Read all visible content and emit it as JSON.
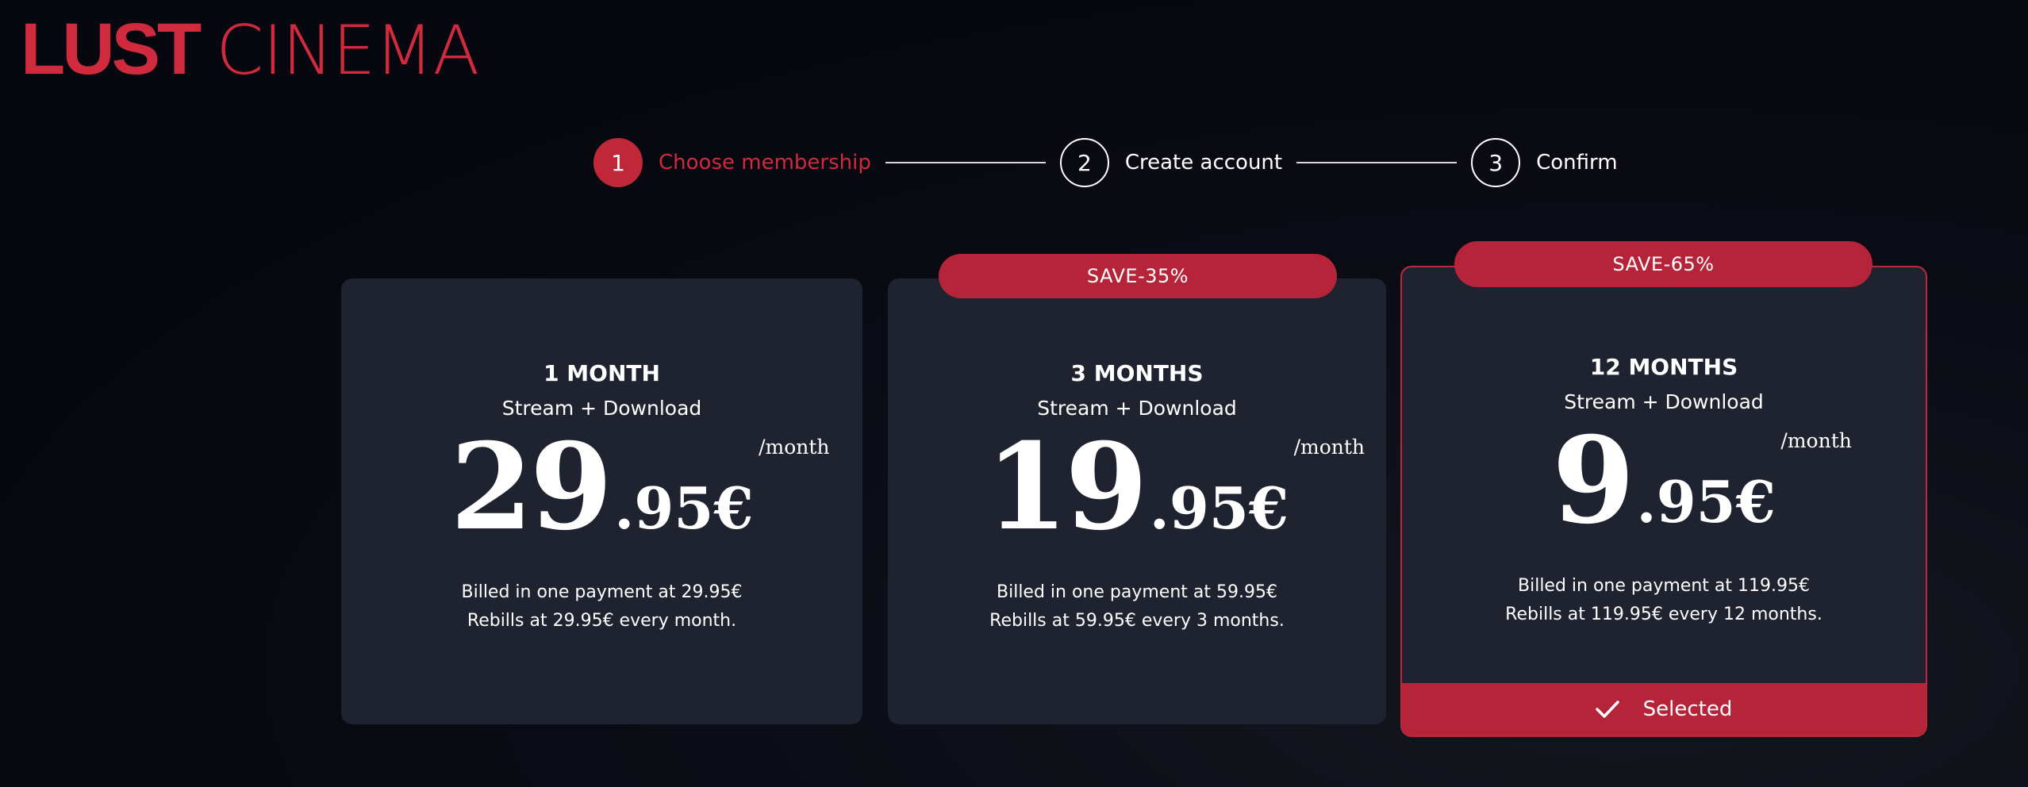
{
  "logo": {
    "bold": "LUST",
    "light": "CINEMA"
  },
  "stepper": [
    {
      "number": "1",
      "label": "Choose membership",
      "active": true
    },
    {
      "number": "2",
      "label": "Create account",
      "active": false
    },
    {
      "number": "3",
      "label": "Confirm",
      "active": false
    }
  ],
  "plans": [
    {
      "title": "1 MONTH",
      "subtitle": "Stream + Download",
      "price_int": "29",
      "price_dec": ".95€",
      "per": "/month",
      "billing_line1": "Billed in one payment at 29.95€",
      "billing_line2": "Rebills at 29.95€ every month.",
      "badge": "",
      "selected": false
    },
    {
      "title": "3 MONTHS",
      "subtitle": "Stream + Download",
      "price_int": "19",
      "price_dec": ".95€",
      "per": "/month",
      "billing_line1": "Billed in one payment at 59.95€",
      "billing_line2": "Rebills at 59.95€ every 3 months.",
      "badge": "SAVE-35%",
      "selected": false
    },
    {
      "title": "12 MONTHS",
      "subtitle": "Stream + Download",
      "price_int": "9",
      "price_dec": ".95€",
      "per": "/month",
      "billing_line1": "Billed in one payment at 119.95€",
      "billing_line2": "Rebills at 119.95€ every 12 months.",
      "badge": "SAVE-65%",
      "selected": true
    }
  ],
  "selected_label": "Selected",
  "colors": {
    "accent": "#c0283a",
    "card_bg": "#1e232f",
    "page_bg": "#07070f"
  }
}
